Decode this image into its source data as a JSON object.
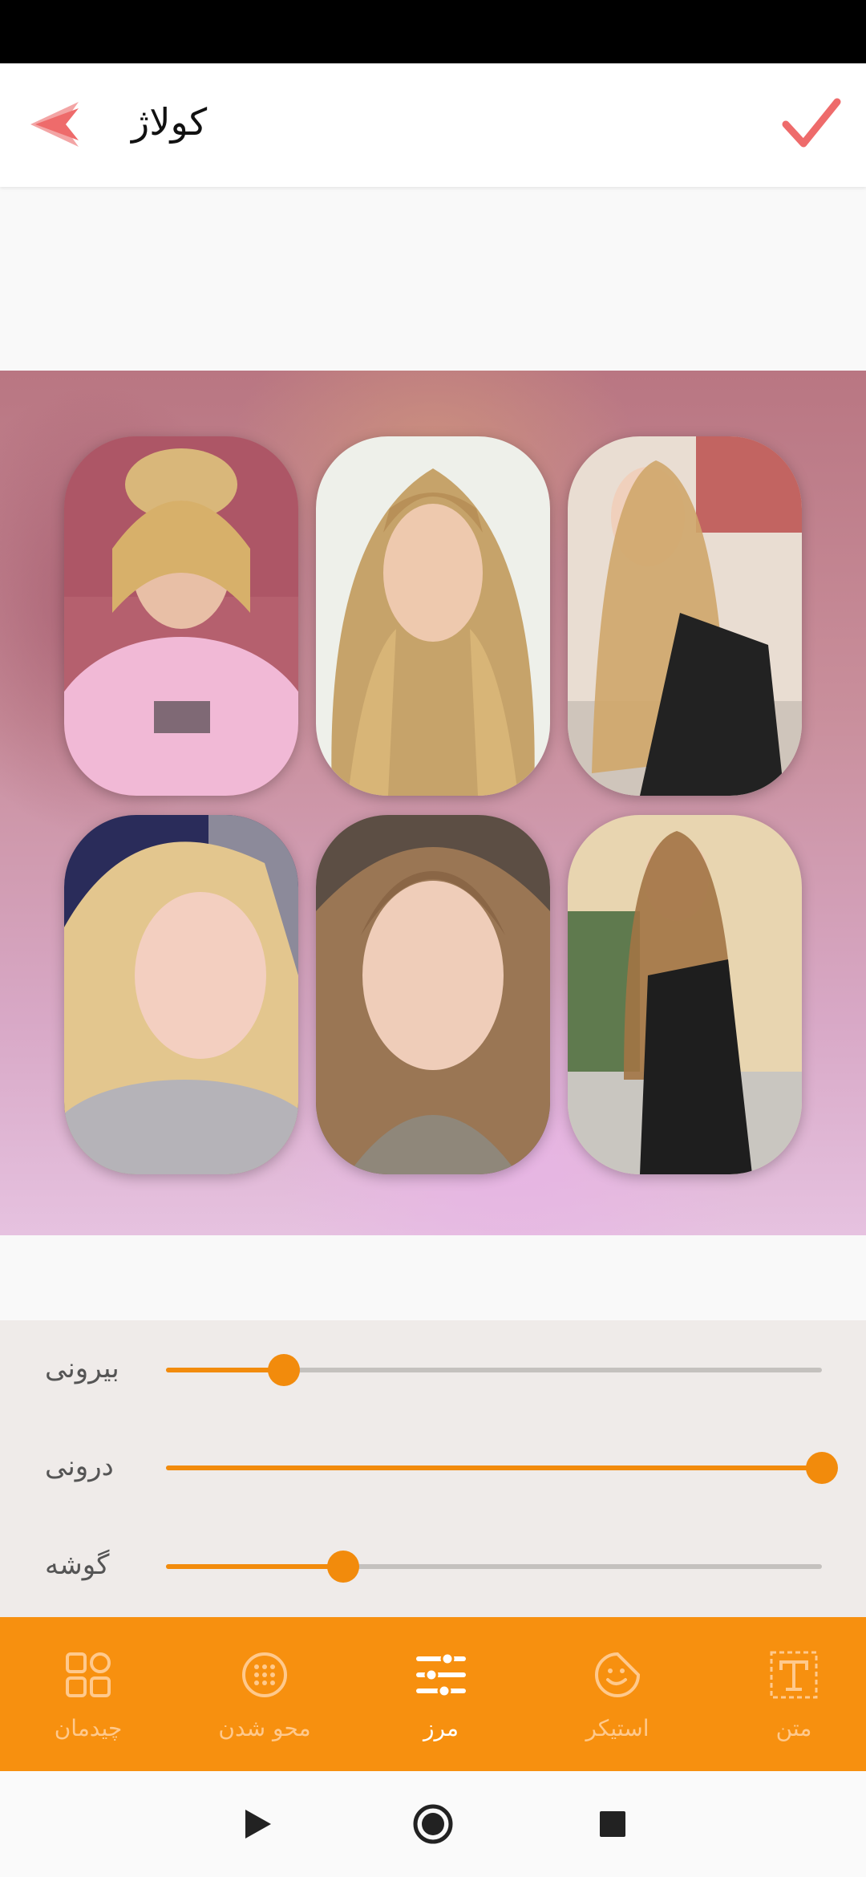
{
  "app_bar": {
    "title": "کولاژ",
    "back_icon": "double-chevron-left-icon",
    "confirm_icon": "check-icon",
    "accent_color": "#ee6b6b"
  },
  "collage": {
    "rows": 2,
    "columns": 3,
    "photos": [
      {
        "name": "photo-1"
      },
      {
        "name": "photo-2"
      },
      {
        "name": "photo-3"
      },
      {
        "name": "photo-4"
      },
      {
        "name": "photo-5"
      },
      {
        "name": "photo-6"
      }
    ]
  },
  "sliders": [
    {
      "label": "بیرونی",
      "value": 0.18
    },
    {
      "label": "درونی",
      "value": 1.0
    },
    {
      "label": "گوشه",
      "value": 0.27
    }
  ],
  "bottom_nav": {
    "items": [
      {
        "label": "چیدمان",
        "icon": "layout-grid-icon",
        "active": false
      },
      {
        "label": "محو شدن",
        "icon": "blur-icon",
        "active": false
      },
      {
        "label": "مرز",
        "icon": "sliders-icon",
        "active": true
      },
      {
        "label": "استیکر",
        "icon": "sticker-smiley-icon",
        "active": false
      },
      {
        "label": "متن",
        "icon": "text-icon",
        "active": false
      }
    ],
    "color": "#f7900f"
  },
  "system_nav": {
    "back_icon": "play-triangle-icon",
    "home_icon": "circle-home-icon",
    "recents_icon": "square-recents-icon"
  }
}
